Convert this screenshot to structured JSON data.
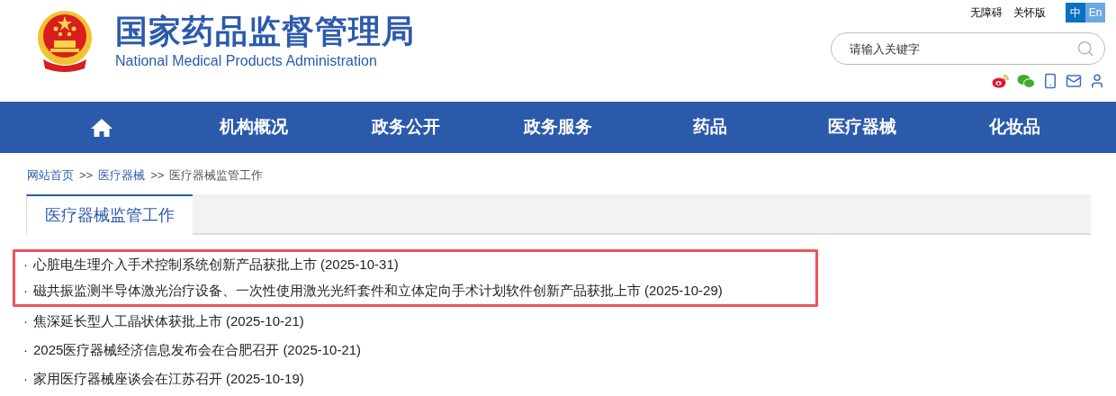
{
  "header": {
    "title": "国家药品监督管理局",
    "subtitle": "National Medical Products Administration",
    "top_links": [
      "无障碍",
      "关怀版"
    ],
    "languages": [
      {
        "label": "中",
        "selected": true
      },
      {
        "label": "En",
        "selected": false
      }
    ],
    "search": {
      "placeholder": "请输入关键字"
    }
  },
  "nav": [
    {
      "kind": "home"
    },
    {
      "kind": "text",
      "label": "机构概况"
    },
    {
      "kind": "text",
      "label": "政务公开"
    },
    {
      "kind": "text",
      "label": "政务服务"
    },
    {
      "kind": "text",
      "label": "药品"
    },
    {
      "kind": "text",
      "label": "医疗器械"
    },
    {
      "kind": "text",
      "label": "化妆品"
    }
  ],
  "breadcrumb": [
    {
      "label": "网站首页",
      "link": true
    },
    {
      "label": ">>",
      "link": false
    },
    {
      "label": "医疗器械",
      "link": true
    },
    {
      "label": ">>",
      "link": false
    },
    {
      "label": "医疗器械监管工作",
      "link": false
    }
  ],
  "tab": {
    "label": "医疗器械监管工作",
    "selected": true
  },
  "articles": [
    {
      "bullet": "·",
      "title": "心脏电生理介入手术控制系统创新产品获批上市",
      "date": "(2025-10-31)",
      "highlighted": true
    },
    {
      "bullet": "·",
      "title": "磁共振监测半导体激光治疗设备、一次性使用激光光纤套件和立体定向手术计划软件创新产品获批上市",
      "date": "(2025-10-29)",
      "highlighted": true
    },
    {
      "bullet": "·",
      "title": "焦深延长型人工晶状体获批上市",
      "date": "(2025-10-21)",
      "highlighted": false
    },
    {
      "bullet": "·",
      "title": "2025医疗器械经济信息发布会在合肥召开",
      "date": "(2025-10-21)",
      "highlighted": false
    },
    {
      "bullet": "·",
      "title": "家用医疗器械座谈会在江苏召开",
      "date": "(2025-10-19)",
      "highlighted": false
    }
  ]
}
